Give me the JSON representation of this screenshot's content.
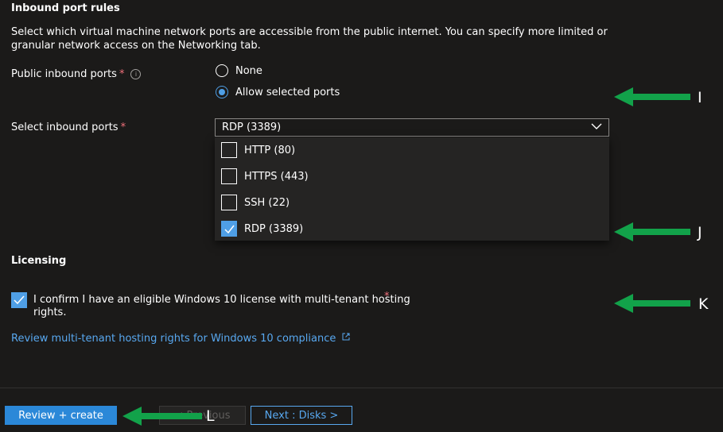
{
  "inbound": {
    "title": "Inbound port rules",
    "description": "Select which virtual machine network ports are accessible from the public internet. You can specify more limited or granular network access on the Networking tab.",
    "public_ports_label": "Public inbound ports",
    "required_mark": "*",
    "info_icon": "i",
    "radio_none": "None",
    "radio_allow": "Allow selected ports",
    "select_ports_label": "Select inbound ports",
    "select_value": "RDP (3389)",
    "options": [
      "HTTP (80)",
      "HTTPS (443)",
      "SSH (22)",
      "RDP (3389)"
    ],
    "selected_option": "RDP (3389)"
  },
  "licensing": {
    "title": "Licensing",
    "confirm_line1": "I confirm I have an eligible Windows 10 license with multi-tenant hosting",
    "confirm_line2": "rights.",
    "required_mark": "*",
    "confirm_checked": true,
    "review_link": "Review multi-tenant hosting rights for Windows 10 compliance"
  },
  "footer": {
    "review_create": "Review + create",
    "previous": "< Previous",
    "next": "Next : Disks >"
  },
  "annotations": {
    "marker_i": "I",
    "marker_j": "J",
    "marker_k": "K",
    "marker_l": "L",
    "arrow_color": "#12a24a"
  },
  "colors": {
    "background": "#1b1a19",
    "accent": "#4f9fe6",
    "link": "#58a8f0",
    "required": "#f1707b"
  }
}
